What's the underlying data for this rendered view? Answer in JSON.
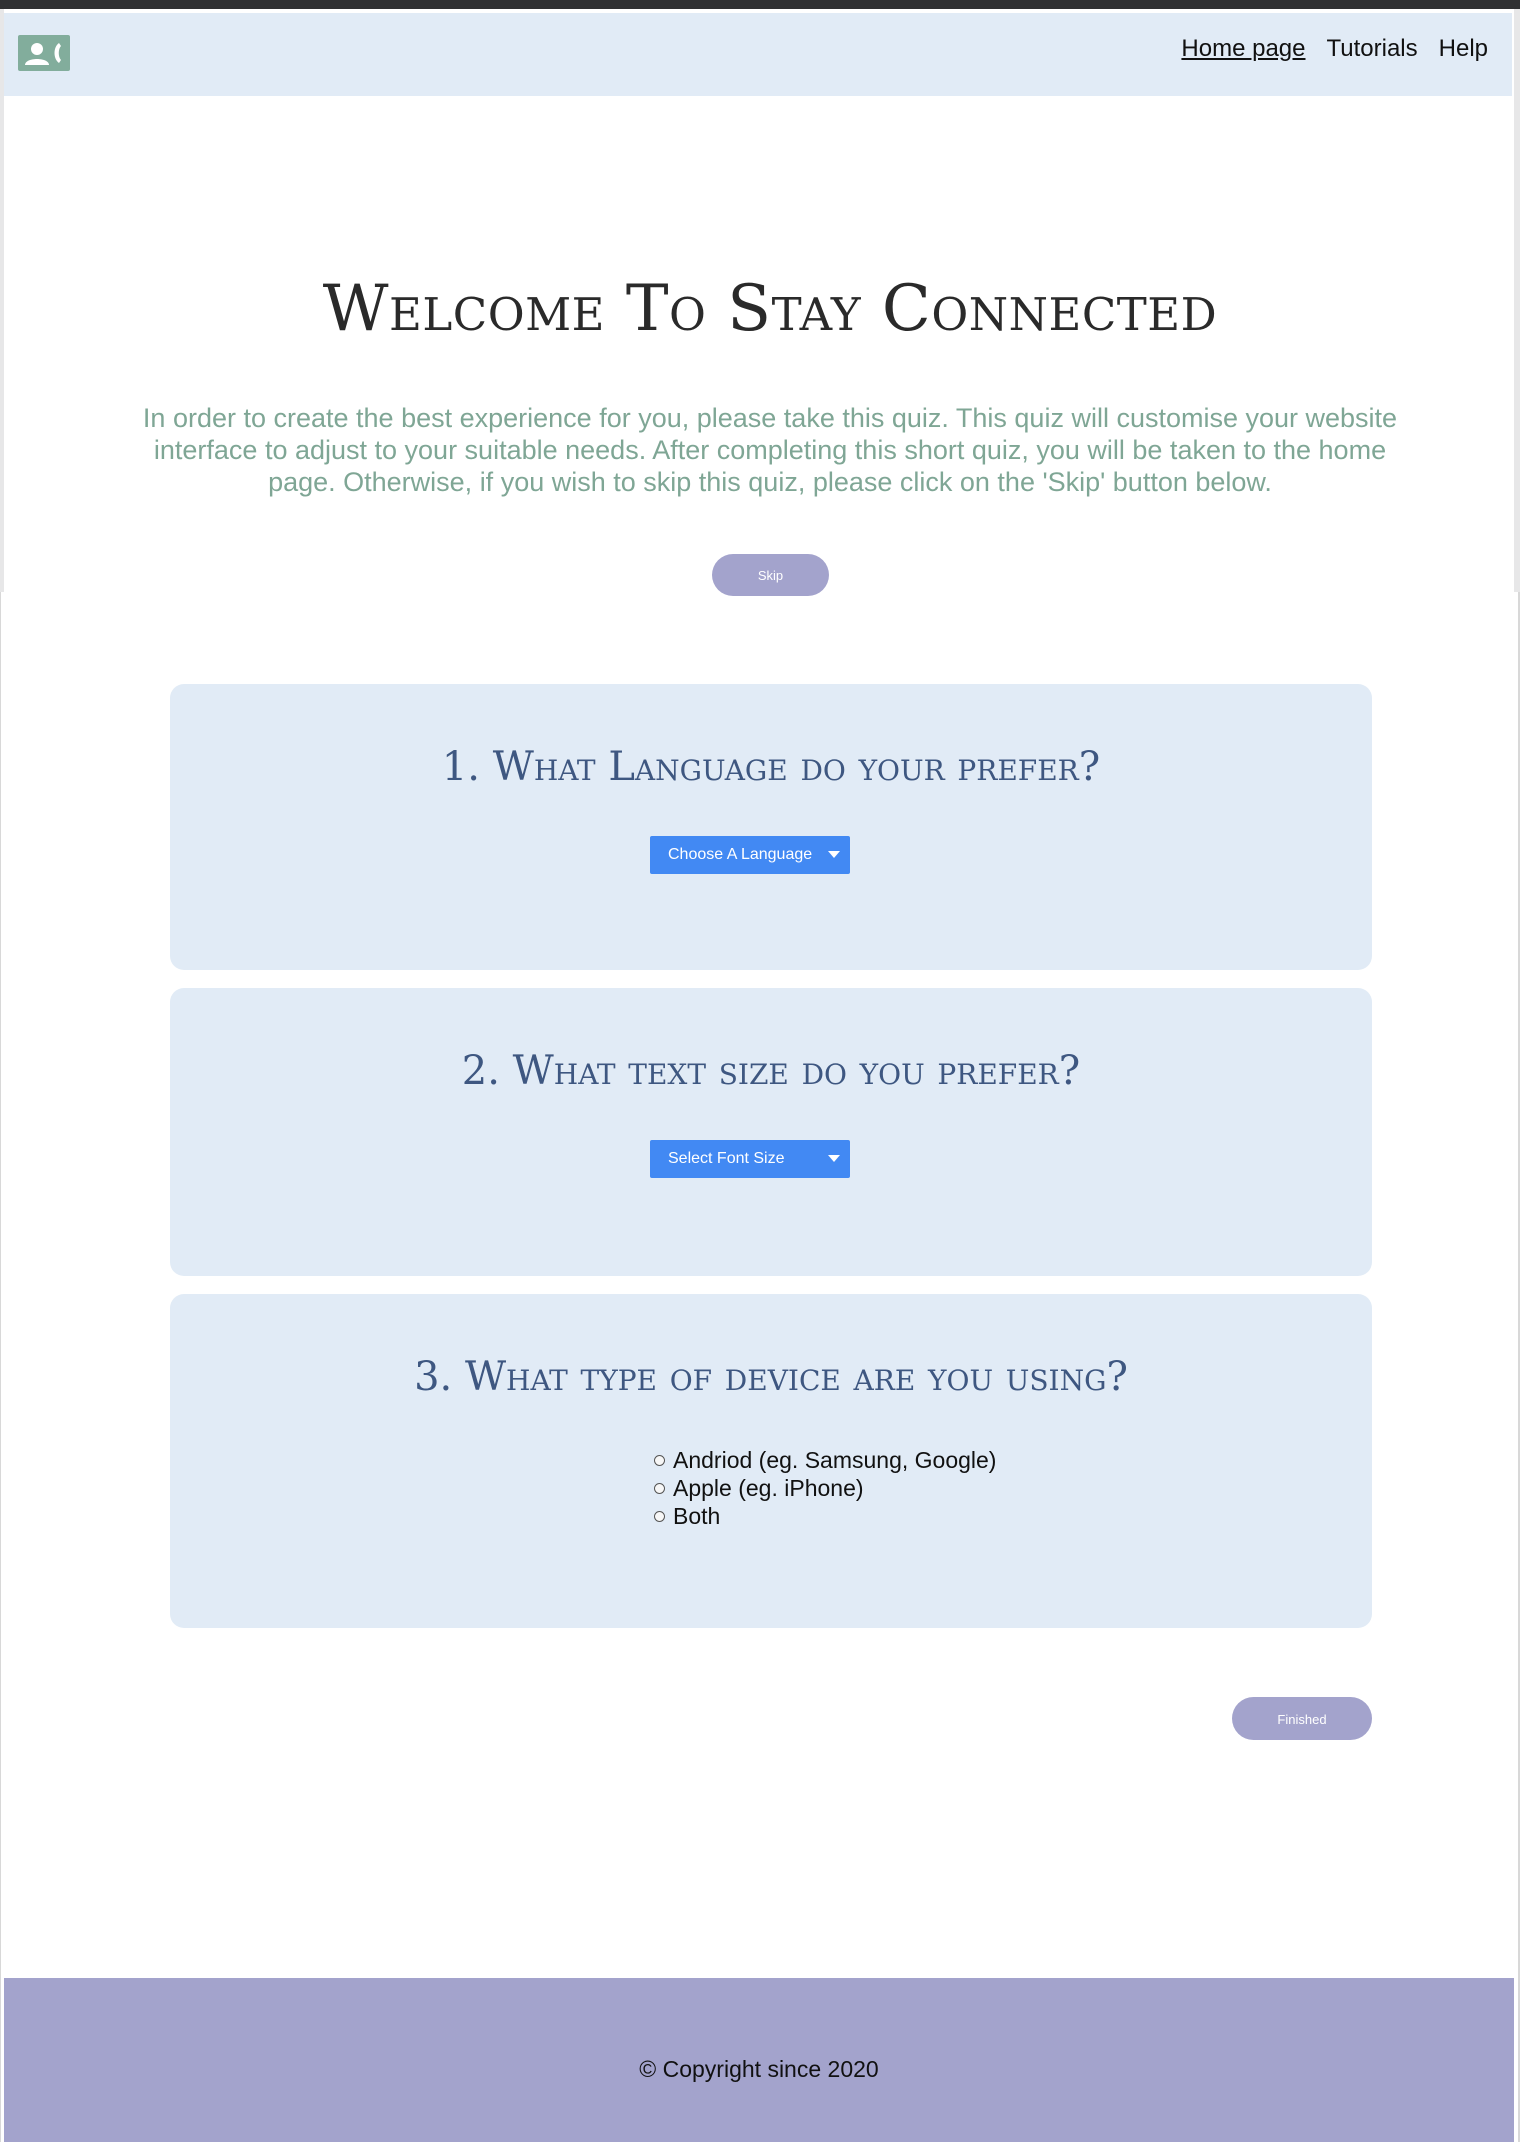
{
  "nav": {
    "logo_icon": "contact-phone-icon",
    "links": [
      {
        "label": "Home page",
        "current": true
      },
      {
        "label": "Tutorials",
        "current": false
      },
      {
        "label": "Help",
        "current": false
      }
    ]
  },
  "hero": {
    "title": "Welcome To Stay Connected",
    "intro": "In order to create the best experience for you, please take this quiz. This quiz will customise your website interface to adjust to your suitable needs. After completing this short quiz, you will be taken to the home page. Otherwise, if you wish to skip this quiz, please click on the 'Skip' button below.",
    "skip_label": "Skip"
  },
  "quiz": {
    "q1": {
      "question": "1. What Language do your prefer?",
      "dropdown_label": "Choose A Language"
    },
    "q2": {
      "question": "2. What text size do you prefer?",
      "dropdown_label": "Select Font Size"
    },
    "q3": {
      "question": "3. What type of device are you using?",
      "options": [
        "Andriod (eg. Samsung, Google)",
        "Apple (eg. iPhone)",
        "Both"
      ]
    },
    "finished_label": "Finished"
  },
  "footer": {
    "copyright": "© Copyright since 2020"
  },
  "colors": {
    "nav_bg": "#e1ebf6",
    "accent_green": "#82ad9c",
    "button_purple": "#a3a3cc",
    "dropdown_blue": "#4289f3",
    "heading_blue": "#3e5781"
  }
}
